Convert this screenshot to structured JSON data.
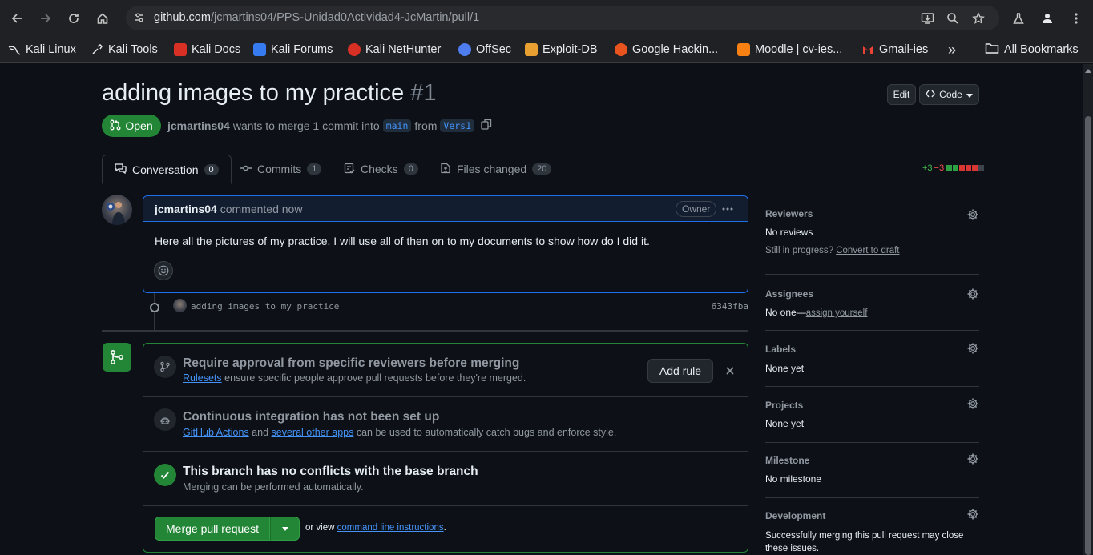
{
  "browser": {
    "url_host": "github.com",
    "url_path": "/jcmartins04/PPS-Unidad0Actividad4-JcMartin/pull/1",
    "bookmarks": [
      {
        "label": "Kali Linux",
        "color": "#367bf0"
      },
      {
        "label": "Kali Tools",
        "color": "#9aa0a6"
      },
      {
        "label": "Kali Docs",
        "color": "#d93025"
      },
      {
        "label": "Kali Forums",
        "color": "#367bf0"
      },
      {
        "label": "Kali NetHunter",
        "color": "#d93025"
      },
      {
        "label": "OffSec",
        "color": "#4e7df0"
      },
      {
        "label": "Exploit-DB",
        "color": "#e8a033"
      },
      {
        "label": "Google Hackin...",
        "color": "#e8531e"
      },
      {
        "label": "Moodle | cv-ies...",
        "color": "#f98012"
      },
      {
        "label": "Gmail-ies",
        "color": "#ea4335"
      }
    ],
    "more_label": "»",
    "all_bookmarks": "All Bookmarks"
  },
  "pr": {
    "title": "adding images to my practice",
    "number": "#1",
    "edit_label": "Edit",
    "code_label": "Code",
    "state": "Open",
    "author": "jcmartins04",
    "meta_text1": "wants to merge 1 commit into",
    "base_branch": "main",
    "meta_from": "from",
    "head_branch": "Vers1"
  },
  "tabs": [
    {
      "label": "Conversation",
      "count": "0"
    },
    {
      "label": "Commits",
      "count": "1"
    },
    {
      "label": "Checks",
      "count": "0"
    },
    {
      "label": "Files changed",
      "count": "20"
    }
  ],
  "diffstat": {
    "added": "+3",
    "removed": "−3",
    "colors": [
      "#2ea043",
      "#2ea043",
      "#da3633",
      "#da3633",
      "#da3633",
      "#3d444d"
    ]
  },
  "comment": {
    "author": "jcmartins04",
    "when": "commented now",
    "badge": "Owner",
    "body": "Here all the pictures of my practice. I will use all of then on to my documents to show how do I did it."
  },
  "commit": {
    "message": "adding images to my practice",
    "sha": "6343fba"
  },
  "merge": {
    "rule_title": "Require approval from specific reviewers before merging",
    "rule_link": "Rulesets",
    "rule_rest": "ensure specific people approve pull requests before they're merged.",
    "add_rule": "Add rule",
    "ci_title": "Continuous integration has not been set up",
    "ci_link1": "GitHub Actions",
    "ci_and": "and",
    "ci_link2": "several other apps",
    "ci_rest": "can be used to automatically catch bugs and enforce style.",
    "conflict_title": "This branch has no conflicts with the base branch",
    "conflict_sub": "Merging can be performed automatically.",
    "merge_button": "Merge pull request",
    "or_view": "or view",
    "cli_link": "command line instructions",
    "period": "."
  },
  "sidebar": {
    "reviewers": {
      "title": "Reviewers",
      "value": "No reviews",
      "progress": "Still in progress?",
      "convert": "Convert to draft"
    },
    "assignees": {
      "title": "Assignees",
      "value": "No one—",
      "assign": "assign yourself"
    },
    "labels": {
      "title": "Labels",
      "value": "None yet"
    },
    "projects": {
      "title": "Projects",
      "value": "None yet"
    },
    "milestone": {
      "title": "Milestone",
      "value": "No milestone"
    },
    "development": {
      "title": "Development",
      "value": "Successfully merging this pull request may close these issues."
    }
  }
}
